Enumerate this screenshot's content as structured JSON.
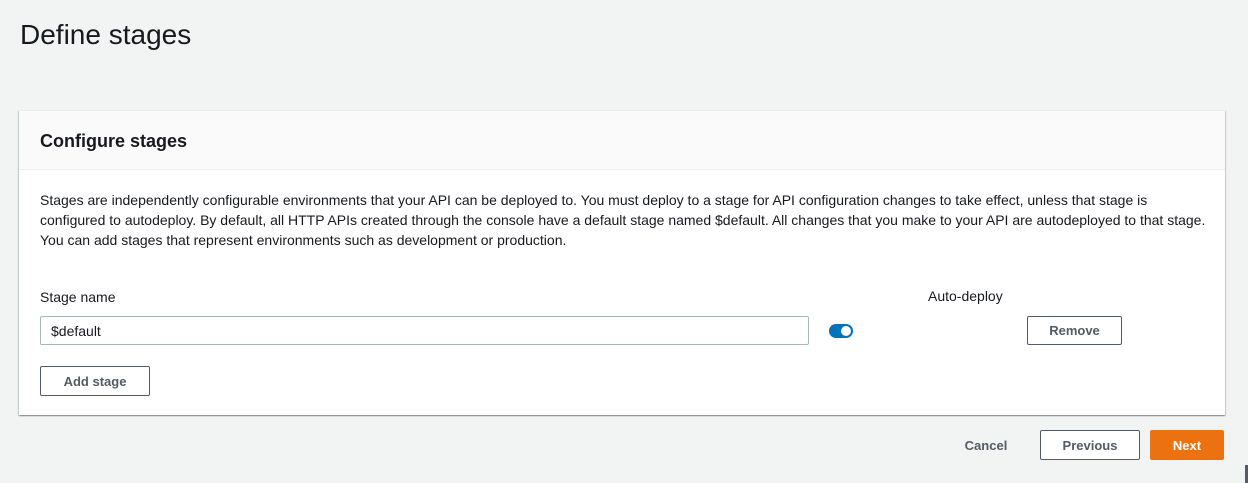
{
  "page": {
    "title": "Define stages"
  },
  "panel": {
    "title": "Configure stages",
    "description": "Stages are independently configurable environments that your API can be deployed to. You must deploy to a stage for API configuration changes to take effect, unless that stage is configured to autodeploy. By default, all HTTP APIs created through the console have a default stage named $default. All changes that you make to your API are autodeployed to that stage. You can add stages that represent environments such as development or production.",
    "stage_name_label": "Stage name",
    "auto_deploy_label": "Auto-deploy",
    "stages": [
      {
        "name": "$default",
        "auto_deploy": true
      }
    ],
    "remove_label": "Remove",
    "add_stage_label": "Add stage"
  },
  "footer": {
    "cancel_label": "Cancel",
    "previous_label": "Previous",
    "next_label": "Next"
  },
  "colors": {
    "accent": "#0073bb",
    "primary_button": "#ec7211",
    "background": "#f2f3f3"
  }
}
